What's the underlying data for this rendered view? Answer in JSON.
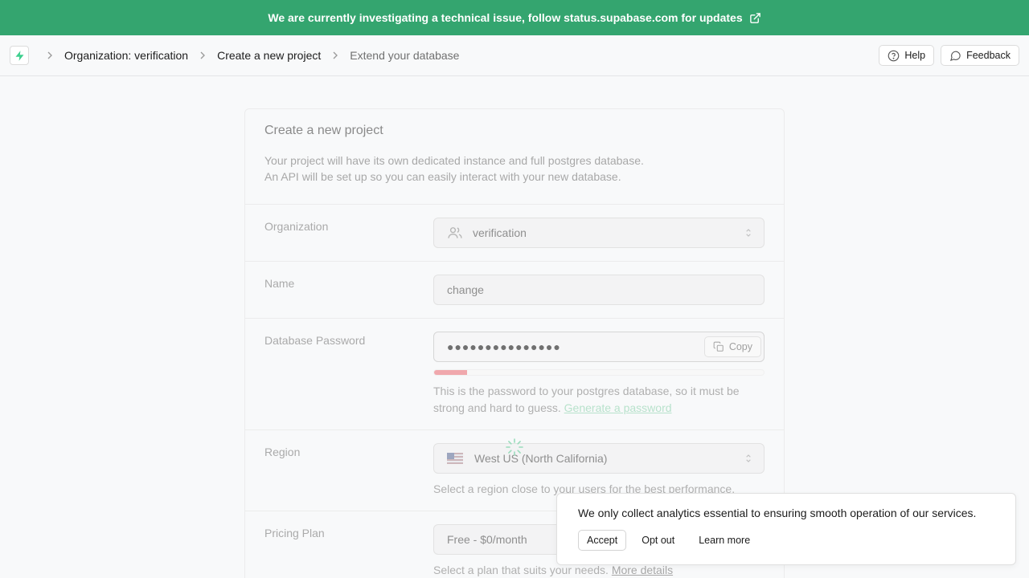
{
  "banner": {
    "text": "We are currently investigating a technical issue, follow status.supabase.com for updates"
  },
  "breadcrumb": {
    "organization": "Organization: verification",
    "create": "Create a new project",
    "extend": "Extend your database"
  },
  "header": {
    "help_label": "Help",
    "feedback_label": "Feedback"
  },
  "form": {
    "title": "Create a new project",
    "desc_line1": "Your project will have its own dedicated instance and full postgres database.",
    "desc_line2": "An API will be set up so you can easily interact with your new database.",
    "organization": {
      "label": "Organization",
      "value": "verification"
    },
    "name": {
      "label": "Name",
      "value": "change"
    },
    "password": {
      "label": "Database Password",
      "value": "●●●●●●●●●●●●●●●",
      "copy_label": "Copy",
      "strength": 0.1,
      "hint": "This is the password to your postgres database, so it must be strong and hard to guess.",
      "generate_label": "Generate a password"
    },
    "region": {
      "label": "Region",
      "value": "West US (North California)",
      "hint": "Select a region close to your users for the best performance."
    },
    "pricing": {
      "label": "Pricing Plan",
      "value": "Free - $0/month",
      "hint": "Select a plan that suits your needs.",
      "details_label": "More details"
    }
  },
  "cookie": {
    "text": "We only collect analytics essential to ensuring smooth operation of our services.",
    "accept_label": "Accept",
    "optout_label": "Opt out",
    "learn_label": "Learn more"
  },
  "colors": {
    "brand": "#34a56f",
    "strength_weak": "#f0a8ad"
  }
}
